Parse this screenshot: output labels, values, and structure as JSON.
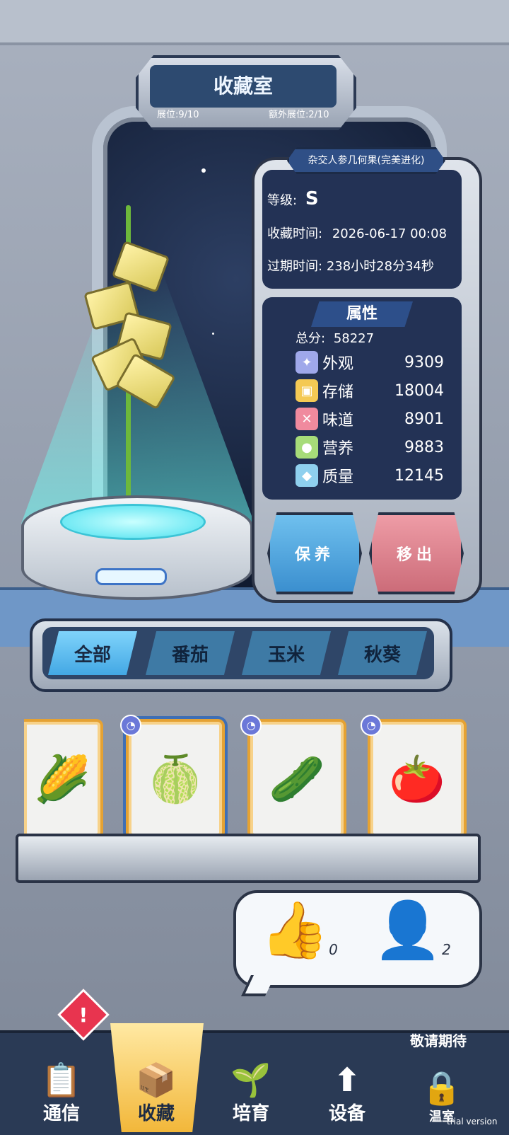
{
  "title": "收藏室",
  "slots": {
    "display": "展位:9/10",
    "extra": "额外展位:2/10"
  },
  "item": {
    "name": "杂交人参几何果(完美进化)",
    "level_label": "等级:",
    "level_value": "S",
    "collect_time_label": "收藏时间:",
    "collect_time": "2026-06-17 00:08",
    "expire_label": "过期时间:",
    "expire_time": "238小时28分34秒"
  },
  "attributes": {
    "title": "属性",
    "total_label": "总分:",
    "total": "58227",
    "rows": [
      {
        "label": "外观",
        "value": "9309",
        "icon": "sparkle-icon",
        "color": "#9fa8ea"
      },
      {
        "label": "存储",
        "value": "18004",
        "icon": "box-icon",
        "color": "#f4c954"
      },
      {
        "label": "味道",
        "value": "8901",
        "icon": "utensils-icon",
        "color": "#f08a9e"
      },
      {
        "label": "营养",
        "value": "9883",
        "icon": "lemon-icon",
        "color": "#a7dc79"
      },
      {
        "label": "质量",
        "value": "12145",
        "icon": "muscle-icon",
        "color": "#8fd0ee"
      }
    ]
  },
  "actions": {
    "maintain": "保养",
    "remove": "移出"
  },
  "tabs": [
    "全部",
    "番茄",
    "玉米",
    "秋葵"
  ],
  "cards": [
    {
      "icon": "corn-icon",
      "glyph": "🌽"
    },
    {
      "icon": "melon-icon",
      "glyph": "🍈"
    },
    {
      "icon": "okra-icon",
      "glyph": "🫛"
    },
    {
      "icon": "persimmon-icon",
      "glyph": "🍅"
    }
  ],
  "social": {
    "likes": "0",
    "visitors": "2"
  },
  "nav": {
    "items": [
      "通信",
      "收藏",
      "培育",
      "设备",
      "温室"
    ],
    "coming_soon": "敬请期待",
    "badge": "!"
  },
  "watermark": "trial version",
  "colors": {
    "accent": "#3aa9de",
    "panel": "#233255",
    "maintain": "#4fa3d8",
    "remove": "#d97c88"
  }
}
